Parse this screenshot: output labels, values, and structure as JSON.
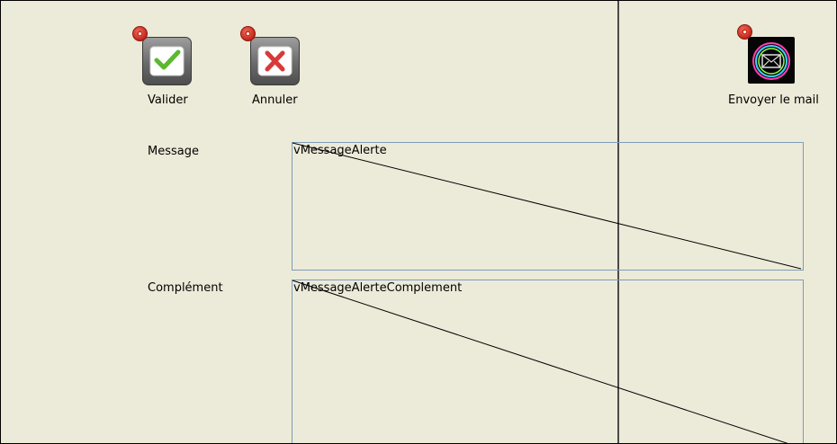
{
  "toolbar": {
    "valider_label": "Valider",
    "annuler_label": "Annuler",
    "envoyer_label": "Envoyer le mail"
  },
  "form": {
    "message_label": "Message",
    "message_value": "vMessageAlerte",
    "complement_label": "Complément",
    "complement_value": "vMessageAlerteComplement"
  },
  "colors": {
    "background": "#ecead8",
    "field_border": "#7f9db9",
    "badge": "#d03020",
    "check_green": "#5cb82e",
    "cross_red": "#d83a3a"
  },
  "icons": [
    "checkmark-icon",
    "cross-icon",
    "envelope-icon",
    "badge-icon"
  ]
}
